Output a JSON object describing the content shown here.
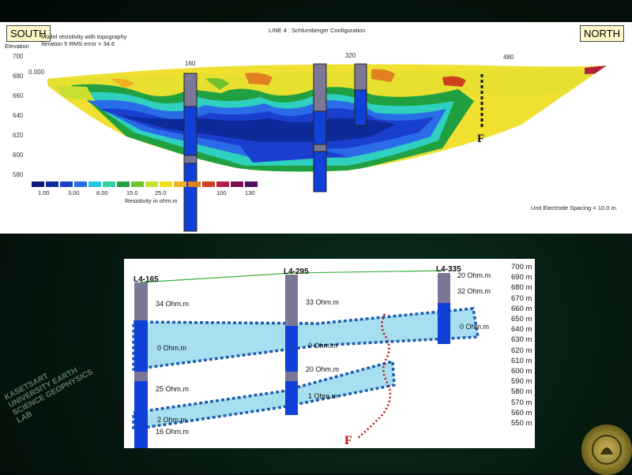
{
  "top": {
    "south": "SOUTH",
    "north": "NORTH",
    "title": "LINE 4 : Schlumberger Configuration",
    "subtitle1": "Model resistivity with topography",
    "subtitle2": "Iteration 5 RMS error = 34.6",
    "elev_label": "Elevation",
    "elev_ticks": [
      "700",
      "680",
      "660",
      "640",
      "620",
      "600",
      "580"
    ],
    "x_ticks": [
      "160",
      "320",
      "480"
    ],
    "start_label": "0.000",
    "scale_values": [
      "1.00",
      "3.00",
      "8.00",
      "15.0",
      "25.0",
      "100",
      "130"
    ],
    "scale_title": "Resistivity in ohm.m",
    "spacing": "Unit Electrode Spacing = 10.0 m.",
    "fault": "F",
    "scale_colors": [
      "#0a1a7a",
      "#0d2a9a",
      "#1a3fcf",
      "#2a6ce8",
      "#20c8e0",
      "#30d0a0",
      "#20a040",
      "#70c030",
      "#c8e030",
      "#f0e020",
      "#f0b020",
      "#e08020",
      "#d04020",
      "#b02040",
      "#7a1050",
      "#501060"
    ]
  },
  "bottom": {
    "boreholes": [
      "L4-165",
      "L4-295",
      "L4-335"
    ],
    "labels": {
      "b1_top": "34 Ohm.m",
      "b1_mid": "0 Ohm.m",
      "b1_low": "25 Ohm.m",
      "b1_low2": "2 Ohm.m",
      "b1_bot": "16 Ohm.m",
      "b2_top": "33 Ohm.m",
      "b2_mid": "0 Ohm.m",
      "b2_low": "20 Ohm.m",
      "b2_low2": "1 Ohm.m",
      "b3_top": "20 Ohm.m",
      "b3_top2": "32 Ohm.m",
      "b3_mid": "0 Ohm.m"
    },
    "elev_ticks": [
      "700 m",
      "690 m",
      "680 m",
      "670 m",
      "660 m",
      "650 m",
      "640 m",
      "630 m",
      "620 m",
      "610 m",
      "600 m",
      "590 m",
      "580 m",
      "570 m",
      "560 m",
      "550 m"
    ],
    "fault": "F"
  },
  "watermark": "KASETSART UNIVERSITY EARTH SCIENCE GEOPHYSICS LAB"
}
